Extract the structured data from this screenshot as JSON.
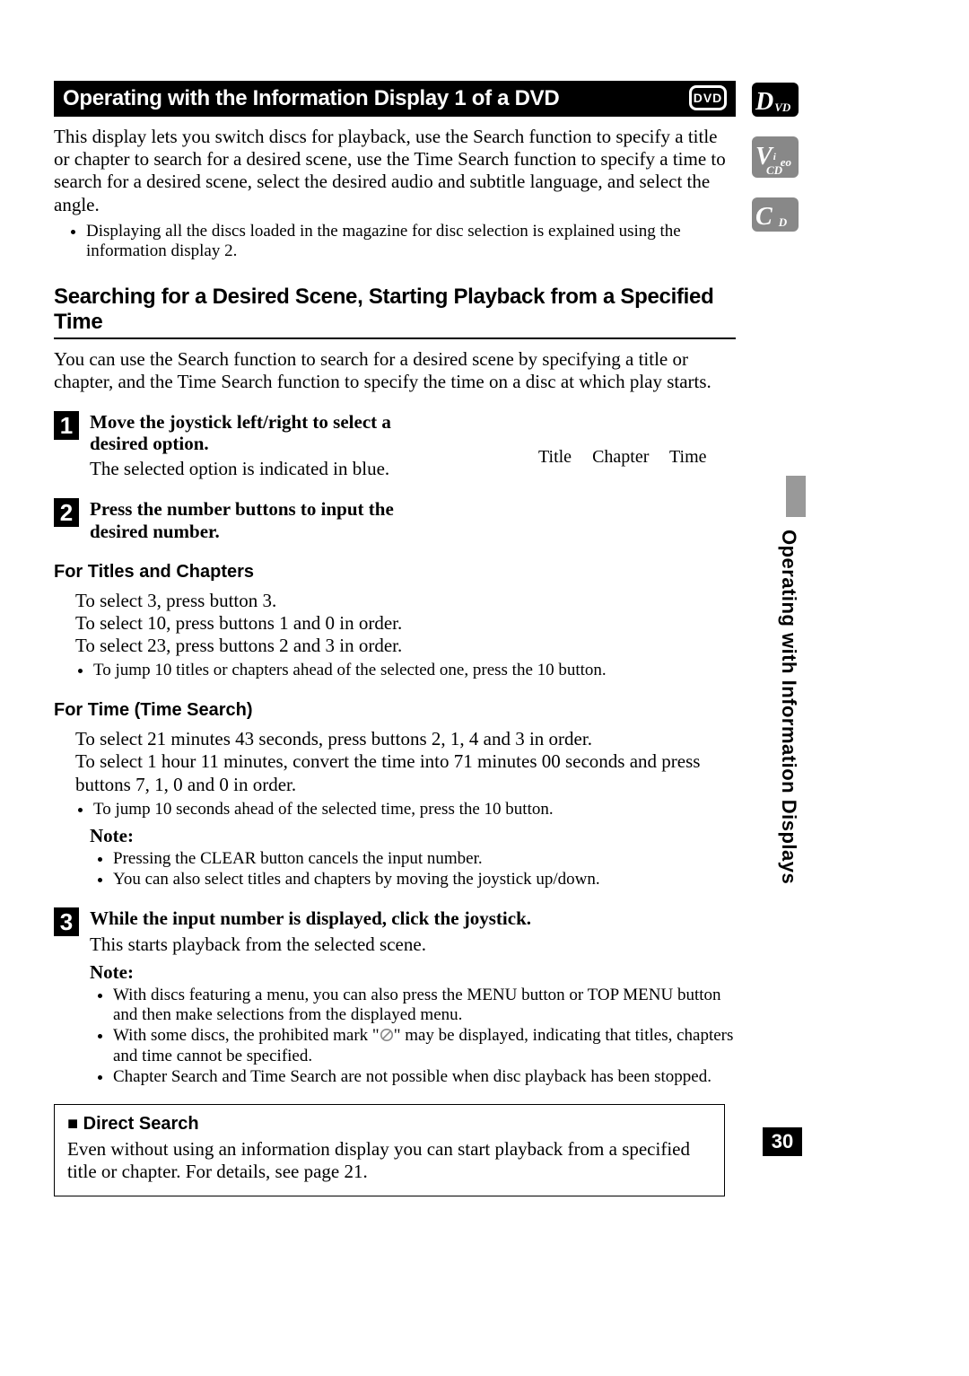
{
  "title_bar": "Operating with the Information Display 1 of a DVD",
  "dvd_badge": "DVD",
  "intro_paragraph": "This display lets you switch discs for playback, use the Search function to specify a title or chapter to search for a desired scene, use the Time Search function to specify a time to search for a desired scene, select the desired audio and subtitle language, and select the angle.",
  "intro_bullet": "Displaying all the discs loaded in the magazine for disc selection is explained using the information display 2.",
  "h2": "Searching for a Desired Scene, Starting Playback from a Specified Time",
  "h2_body": "You can use the Search function to search for a desired scene by specifying a title or chapter, and the Time Search function to specify the time on a disc at which play starts.",
  "steps": {
    "s1": {
      "num": "1",
      "head": "Move the joystick left/right to select a desired option.",
      "body": "The selected option is indicated in blue."
    },
    "s2": {
      "num": "2",
      "head": "Press the number buttons to input the desired number."
    },
    "s3": {
      "num": "3",
      "head": "While the input number is displayed, click the joystick.",
      "body": "This starts playback from the selected scene."
    }
  },
  "options": {
    "a": "Title",
    "b": "Chapter",
    "c": "Time"
  },
  "sub1": {
    "head": "For Titles and Chapters",
    "l1": "To select 3, press button 3.",
    "l2": "To select 10, press buttons 1 and 0 in order.",
    "l3": "To select 23, press buttons 2 and 3 in order.",
    "b1": "To jump 10 titles or chapters ahead of the selected one, press the 10 button."
  },
  "sub2": {
    "head": "For Time (Time Search)",
    "l1": "To select 21 minutes 43 seconds, press buttons 2, 1, 4 and 3 in order.",
    "l2": "To select 1 hour 11 minutes, convert the time into 71 minutes 00 seconds and press buttons 7, 1, 0 and 0 in order.",
    "b1": "To jump 10 seconds ahead of the selected time, press the 10 button."
  },
  "note1": {
    "label": "Note:",
    "b1": "Pressing the CLEAR button cancels the input number.",
    "b2": "You can also select titles and chapters by moving the joystick up/down."
  },
  "note2": {
    "label": "Note:",
    "b1": "With discs featuring a menu, you can also press the MENU button or TOP MENU button and then make selections from the displayed menu.",
    "b2a": "With some discs, the prohibited mark \"",
    "b2b": "\" may be displayed, indicating that titles, chapters and time cannot be specified.",
    "b3": "Chapter Search and Time Search are not possible when disc playback has been stopped."
  },
  "box": {
    "title": "Direct Search",
    "body": "Even without using an information display you can start playback from a specified title or chapter. For details, see page 21."
  },
  "sidebar": {
    "dvd_big": "D",
    "dvd_small": "VD",
    "video_big": "V",
    "video_mid": "i",
    "video_small": "eo",
    "video_sub": "CD",
    "cd_big": "C",
    "cd_small": "D",
    "vtext": "Operating with Information Displays",
    "pagenum": "30"
  }
}
